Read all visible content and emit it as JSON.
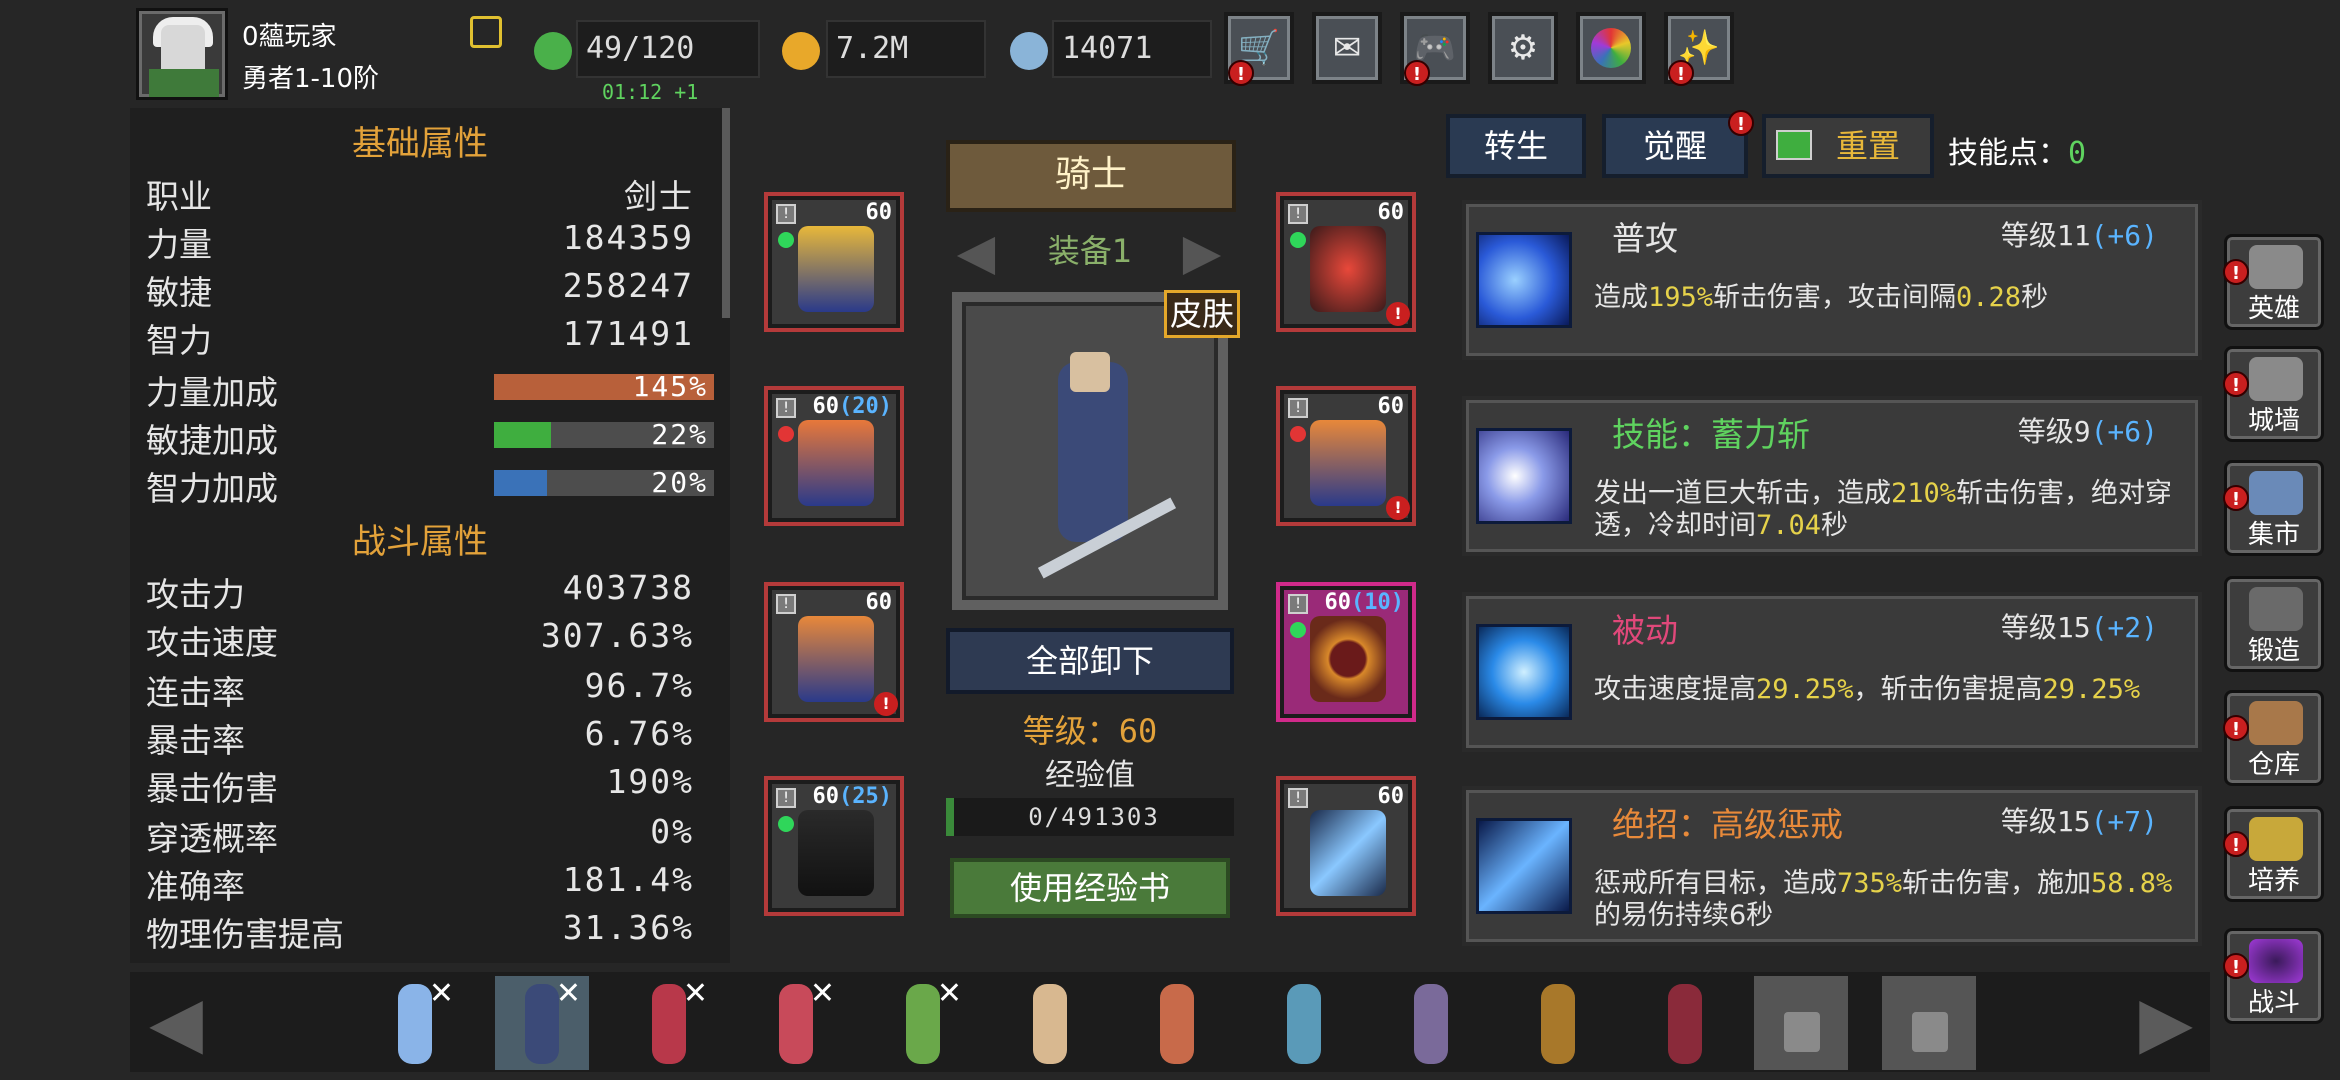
{
  "player": {
    "name": "0蘊玩家",
    "rank": "勇者1-10阶"
  },
  "resources": {
    "energy": "49/120",
    "gold": "7.2M",
    "gems": "14071",
    "timer": "01:12 +1"
  },
  "toolbar": [
    "shop",
    "mail",
    "gamepad",
    "settings",
    "color-wheel",
    "fireworks"
  ],
  "stats": {
    "basic_title": "基础属性",
    "basic": [
      {
        "label": "职业",
        "value": "剑士"
      },
      {
        "label": "力量",
        "value": "184359"
      },
      {
        "label": "敏捷",
        "value": "258247"
      },
      {
        "label": "智力",
        "value": "171491"
      }
    ],
    "bonus": [
      {
        "label": "力量加成",
        "value": "145%",
        "pct": 1.0,
        "color": "#b8603a"
      },
      {
        "label": "敏捷加成",
        "value": "22%",
        "pct": 0.22,
        "color": "#3fae3f"
      },
      {
        "label": "智力加成",
        "value": "20%",
        "pct": 0.2,
        "color": "#3a72b8"
      }
    ],
    "combat_title": "战斗属性",
    "combat": [
      {
        "label": "攻击力",
        "value": "403738"
      },
      {
        "label": "攻击速度",
        "value": "307.63%"
      },
      {
        "label": "连击率",
        "value": "96.7%"
      },
      {
        "label": "暴击率",
        "value": "6.76%"
      },
      {
        "label": "暴击伤害",
        "value": "190%"
      },
      {
        "label": "穿透概率",
        "value": "0%"
      },
      {
        "label": "准确率",
        "value": "181.4%"
      },
      {
        "label": "物理伤害提高",
        "value": "31.36%"
      }
    ]
  },
  "equipment": {
    "class_name": "骑士",
    "set_name": "装备1",
    "skin": "皮肤",
    "unequip": "全部卸下",
    "level": "等级：60",
    "exp_label": "经验值",
    "exp": "0/491303",
    "use_book": "使用经验书",
    "left": [
      {
        "lv": "60",
        "extra": ""
      },
      {
        "lv": "60",
        "extra": "(20)"
      },
      {
        "lv": "60",
        "extra": ""
      },
      {
        "lv": "60",
        "extra": "(25)"
      }
    ],
    "right": [
      {
        "lv": "60",
        "extra": ""
      },
      {
        "lv": "60",
        "extra": ""
      },
      {
        "lv": "60",
        "extra": "(10)"
      },
      {
        "lv": "60",
        "extra": ""
      }
    ]
  },
  "skills": {
    "tabs": [
      "转生",
      "觉醒",
      "重置"
    ],
    "points_label": "技能点：",
    "points": "0",
    "cards": [
      {
        "name": "普攻",
        "name_color": "#e6e6e6",
        "level": "等级11",
        "bonus": "(+6)",
        "d1": "造成",
        "v1": "195%",
        "d2": "斩击伤害，攻击间隔",
        "v2": "0.28",
        "d3": "秒"
      },
      {
        "name": "技能：蓄力斩",
        "name_color": "#5fd35f",
        "level": "等级9",
        "bonus": "(+6)",
        "d1": "发出一道巨大斩击，造成",
        "v1": "210%",
        "d2": "斩击伤害，绝对穿透，冷却时间",
        "v2": "7.04",
        "d3": "秒"
      },
      {
        "name": "被动",
        "name_color": "#e0487a",
        "level": "等级15",
        "bonus": "(+2)",
        "d1": "攻击速度提高",
        "v1": "29.25%",
        "d2": "，斩击伤害提高",
        "v2": "29.25%",
        "d3": ""
      },
      {
        "name": "绝招：高级惩戒",
        "name_color": "#e88a3a",
        "level": "等级15",
        "bonus": "(+7)",
        "d1": "惩戒所有目标，造成",
        "v1": "735%",
        "d2": "斩击伤害，施加",
        "v2": "58.8%",
        "d3": "的易伤持续6秒"
      }
    ]
  },
  "menu": [
    "英雄",
    "城墙",
    "集市",
    "锻造",
    "仓库",
    "培养",
    "战斗"
  ],
  "heroes": [
    {
      "color": "#8ab4e8",
      "x": true
    },
    {
      "color": "#3b4a78",
      "x": true
    },
    {
      "color": "#b8384a",
      "x": true
    },
    {
      "color": "#c84a5a",
      "x": true
    },
    {
      "color": "#6aa84a",
      "x": true
    },
    {
      "color": "#d8b890",
      "x": false
    },
    {
      "color": "#c86a4a",
      "x": false
    },
    {
      "color": "#5a9ab8",
      "x": false
    },
    {
      "color": "#7a6a9a",
      "x": false
    },
    {
      "color": "#a8782a",
      "x": false
    },
    {
      "color": "#8a2a3a",
      "x": false
    }
  ]
}
